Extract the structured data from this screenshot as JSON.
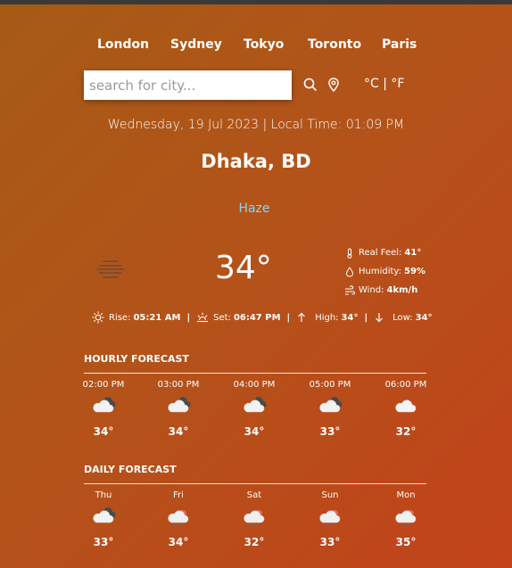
{
  "cities": [
    "London",
    "Sydney",
    "Tokyo",
    "Toronto",
    "Paris"
  ],
  "search": {
    "placeholder": "search for city..."
  },
  "units": {
    "celsius": "°C",
    "separator": "|",
    "fahrenheit": "°F"
  },
  "datetime": "Wednesday, 19 Jul 2023 | Local Time: 01:09 PM",
  "location": "Dhaka, BD",
  "condition": "Haze",
  "temperature": "34°",
  "details": {
    "real_feel_label": "Real Feel:",
    "real_feel": "41°",
    "humidity_label": "Humidity:",
    "humidity": "59%",
    "wind_label": "Wind:",
    "wind": "4km/h"
  },
  "sun": {
    "rise_label": "Rise:",
    "rise": "05:21 AM",
    "set_label": "Set:",
    "set": "06:47 PM",
    "high_label": "High:",
    "high": "34°",
    "low_label": "Low:",
    "low": "34°",
    "separator": "|"
  },
  "hourly": {
    "title": "HOURLY FORECAST",
    "items": [
      {
        "label": "02:00 PM",
        "temp": "34°",
        "icon": "cloud-dark-icon"
      },
      {
        "label": "03:00 PM",
        "temp": "34°",
        "icon": "cloud-dark-icon"
      },
      {
        "label": "04:00 PM",
        "temp": "34°",
        "icon": "cloud-dark-icon"
      },
      {
        "label": "05:00 PM",
        "temp": "33°",
        "icon": "cloud-dark-icon"
      },
      {
        "label": "06:00 PM",
        "temp": "32°",
        "icon": "cloud-icon"
      }
    ]
  },
  "daily": {
    "title": "DAILY FORECAST",
    "items": [
      {
        "label": "Thu",
        "temp": "33°",
        "icon": "cloud-dark-icon"
      },
      {
        "label": "Fri",
        "temp": "34°",
        "icon": "rain-cloud-icon"
      },
      {
        "label": "Sat",
        "temp": "32°",
        "icon": "rain-cloud-icon"
      },
      {
        "label": "Sun",
        "temp": "33°",
        "icon": "rain-cloud-icon"
      },
      {
        "label": "Mon",
        "temp": "35°",
        "icon": "rain-cloud-icon"
      }
    ]
  }
}
